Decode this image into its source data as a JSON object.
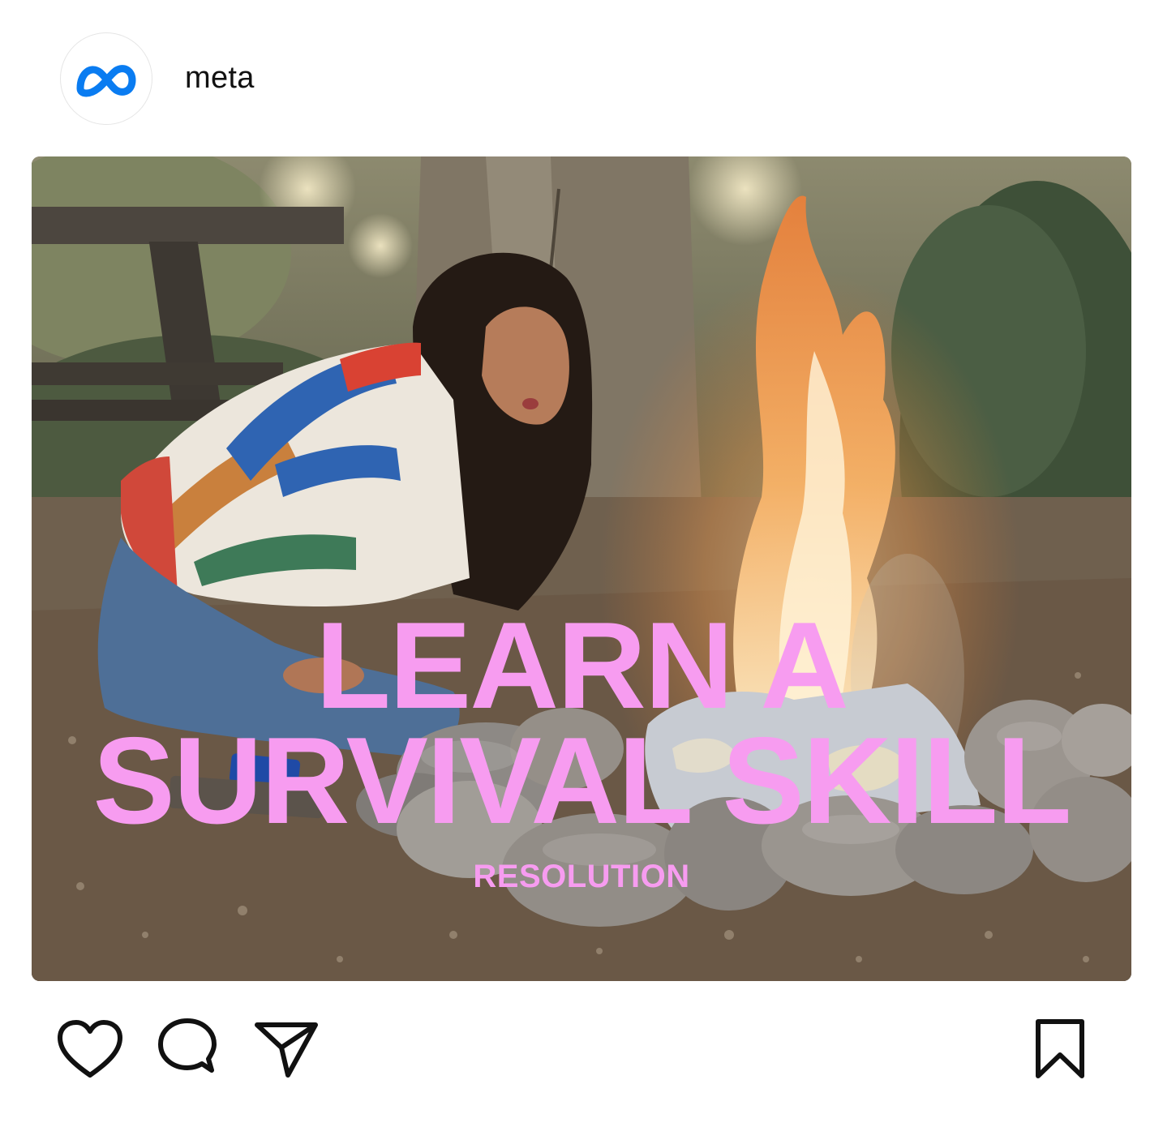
{
  "post": {
    "author": {
      "username": "meta",
      "avatar_icon": "meta-logo-icon"
    },
    "media": {
      "headline_line1": "LEARN A",
      "headline_line2": "SURVIVAL SKILL",
      "subhead": "RESOLUTION",
      "text_color": "#f79cf0"
    },
    "actions": {
      "like_icon": "heart-icon",
      "comment_icon": "comment-bubble-icon",
      "share_icon": "paper-plane-icon",
      "save_icon": "bookmark-icon"
    }
  },
  "colors": {
    "meta_blue": "#0a7cf1",
    "icon_stroke": "#111111",
    "background": "#ffffff"
  }
}
